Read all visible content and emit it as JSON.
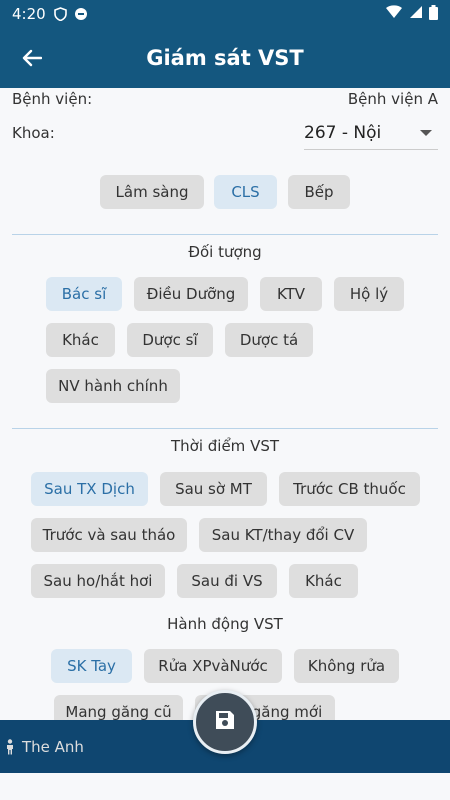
{
  "status": {
    "time": "4:20"
  },
  "appbar": {
    "title": "Giám sát VST"
  },
  "hospital": {
    "label": "Bệnh viện:",
    "value": "Bệnh viện A"
  },
  "khoa": {
    "label": "Khoa:",
    "value": "267 - Nội"
  },
  "categories": [
    {
      "label": "Lâm sàng",
      "selected": false
    },
    {
      "label": "CLS",
      "selected": true
    },
    {
      "label": "Bếp",
      "selected": false
    }
  ],
  "doi_tuong": {
    "title": "Đối tượng",
    "items": [
      {
        "label": "Bác sĩ",
        "selected": true
      },
      {
        "label": "Điều Dưỡng",
        "selected": false
      },
      {
        "label": "KTV",
        "selected": false
      },
      {
        "label": "Hộ lý",
        "selected": false
      },
      {
        "label": "Khác",
        "selected": false
      },
      {
        "label": "Dược sĩ",
        "selected": false
      },
      {
        "label": "Dược tá",
        "selected": false
      },
      {
        "label": "NV hành chính",
        "selected": false
      }
    ]
  },
  "thoi_diem": {
    "title": "Thời điểm VST",
    "items": [
      {
        "label": "Sau TX Dịch",
        "selected": true
      },
      {
        "label": "Sau sờ MT",
        "selected": false
      },
      {
        "label": "Trước CB thuốc",
        "selected": false
      },
      {
        "label": "Trước và sau tháo",
        "selected": false
      },
      {
        "label": "Sau KT/thay đổi CV",
        "selected": false
      },
      {
        "label": "Sau ho/hắt hơi",
        "selected": false
      },
      {
        "label": "Sau đi VS",
        "selected": false
      },
      {
        "label": "Khác",
        "selected": false
      }
    ]
  },
  "hanh_dong": {
    "title": "Hành động VST",
    "items": [
      {
        "label": "SK Tay",
        "selected": true
      },
      {
        "label": "Rửa XPvàNước",
        "selected": false
      },
      {
        "label": "Không rửa",
        "selected": false
      },
      {
        "label": "Mang găng cũ",
        "selected": false
      },
      {
        "label": "găng mới",
        "selected": false
      }
    ]
  },
  "footer": {
    "user": "The Anh"
  },
  "icons": {
    "back": "arrow-left-icon",
    "save": "save-icon",
    "person": "person-icon"
  }
}
